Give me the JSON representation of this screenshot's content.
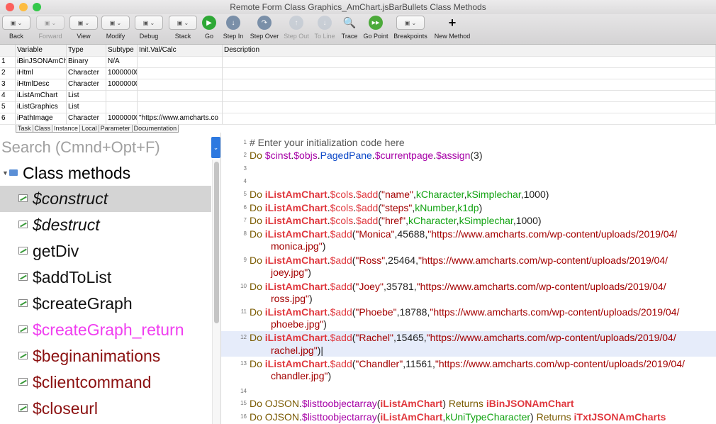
{
  "window": {
    "title": "Remote Form Class Graphics_AmChart.jsBarBullets Class Methods",
    "lights": [
      "#fc605c",
      "#fdbc40",
      "#34c84a"
    ]
  },
  "toolbar": [
    {
      "label": "Back",
      "icon": "back-arrow-icon",
      "disabled": false
    },
    {
      "label": "Forward",
      "icon": "forward-arrow-icon",
      "disabled": true
    },
    {
      "label": "View",
      "icon": "view-icon",
      "disabled": false
    },
    {
      "label": "Modify",
      "icon": "modify-icon",
      "disabled": false
    },
    {
      "label": "Debug",
      "icon": "debug-icon",
      "disabled": false
    },
    {
      "label": "Stack",
      "icon": "stack-icon",
      "disabled": false
    },
    {
      "label": "Go",
      "icon": "go-play-icon",
      "disabled": false
    },
    {
      "label": "Step In",
      "icon": "step-in-icon",
      "disabled": false
    },
    {
      "label": "Step Over",
      "icon": "step-over-icon",
      "disabled": false
    },
    {
      "label": "Step Out",
      "icon": "step-out-icon",
      "disabled": true
    },
    {
      "label": "To Line",
      "icon": "to-line-icon",
      "disabled": true
    },
    {
      "label": "Trace",
      "icon": "trace-icon",
      "disabled": false
    },
    {
      "label": "Go Point",
      "icon": "go-point-icon",
      "disabled": false
    },
    {
      "label": "Breakpoints",
      "icon": "breakpoints-icon",
      "disabled": false
    },
    {
      "label": "New Method",
      "icon": "plus-icon",
      "disabled": false
    }
  ],
  "variables": {
    "headers": [
      "",
      "Variable",
      "Type",
      "Subtype",
      "Init.Val/Calc",
      "Description"
    ],
    "rows": [
      [
        "1",
        "iBinJSONAmCh",
        "Binary",
        "N/A",
        "",
        ""
      ],
      [
        "2",
        "iHtml",
        "Character",
        "10000000",
        "",
        ""
      ],
      [
        "3",
        "iHtmlDesc",
        "Character",
        "10000000",
        "",
        ""
      ],
      [
        "4",
        "iListAmChart",
        "List",
        "",
        "",
        ""
      ],
      [
        "5",
        "iListGraphics",
        "List",
        "",
        "",
        ""
      ],
      [
        "6",
        "iPathImage",
        "Character",
        "10000000",
        "\"https://www.amcharts.co",
        ""
      ]
    ]
  },
  "var_tabs": [
    "Task",
    "Class",
    "Instance",
    "Local",
    "Parameter",
    "Documentation"
  ],
  "search": {
    "placeholder": "Search (Cmnd+Opt+F)"
  },
  "tree": {
    "root": "Class methods",
    "methods": [
      {
        "name": "$construct",
        "style": "italic",
        "color": "#111111",
        "selected": true
      },
      {
        "name": "$destruct",
        "style": "italic",
        "color": "#111111",
        "selected": false
      },
      {
        "name": "getDiv",
        "style": "normal",
        "color": "#111111",
        "selected": false
      },
      {
        "name": "$addToList",
        "style": "normal",
        "color": "#111111",
        "selected": false
      },
      {
        "name": "$createGraph",
        "style": "normal",
        "color": "#111111",
        "selected": false
      },
      {
        "name": "$createGraph_return",
        "style": "normal",
        "color": "#f03ef0",
        "selected": false
      },
      {
        "name": "$beginanimations",
        "style": "normal",
        "color": "#8b1010",
        "selected": false
      },
      {
        "name": "$clientcommand",
        "style": "normal",
        "color": "#8b1010",
        "selected": false
      },
      {
        "name": "$closeurl",
        "style": "normal",
        "color": "#8b1010",
        "selected": false
      }
    ]
  },
  "code": [
    {
      "n": "1",
      "parts": [
        [
          "cm",
          "# Enter your initialization code here"
        ]
      ]
    },
    {
      "n": "2",
      "parts": [
        [
          "kw",
          "Do "
        ],
        [
          "fn",
          "$cinst"
        ],
        [
          "plain",
          "."
        ],
        [
          "fn",
          "$objs"
        ],
        [
          "plain",
          "."
        ],
        [
          "prop",
          "PagedPane"
        ],
        [
          "plain",
          "."
        ],
        [
          "fn",
          "$currentpage"
        ],
        [
          "plain",
          "."
        ],
        [
          "fn",
          "$assign"
        ],
        [
          "plain",
          "(3)"
        ]
      ]
    },
    {
      "n": "3",
      "parts": []
    },
    {
      "n": "4",
      "parts": []
    },
    {
      "n": "5",
      "parts": [
        [
          "kw",
          "Do "
        ],
        [
          "var",
          "iListAmChart"
        ],
        [
          "plain",
          "."
        ],
        [
          "pv",
          "$cols"
        ],
        [
          "plain",
          "."
        ],
        [
          "pv",
          "$add"
        ],
        [
          "plain",
          "("
        ],
        [
          "str",
          "\"name\""
        ],
        [
          "plain",
          ","
        ],
        [
          "kc",
          "kCharacter"
        ],
        [
          "plain",
          ","
        ],
        [
          "kc",
          "kSimplechar"
        ],
        [
          "plain",
          ",1000)"
        ]
      ]
    },
    {
      "n": "6",
      "parts": [
        [
          "kw",
          "Do "
        ],
        [
          "var",
          "iListAmChart"
        ],
        [
          "plain",
          "."
        ],
        [
          "pv",
          "$cols"
        ],
        [
          "plain",
          "."
        ],
        [
          "pv",
          "$add"
        ],
        [
          "plain",
          "("
        ],
        [
          "str",
          "\"steps\""
        ],
        [
          "plain",
          ","
        ],
        [
          "kc",
          "kNumber"
        ],
        [
          "plain",
          ","
        ],
        [
          "kc",
          "k1dp"
        ],
        [
          "plain",
          ")"
        ]
      ]
    },
    {
      "n": "7",
      "parts": [
        [
          "kw",
          "Do "
        ],
        [
          "var",
          "iListAmChart"
        ],
        [
          "plain",
          "."
        ],
        [
          "pv",
          "$cols"
        ],
        [
          "plain",
          "."
        ],
        [
          "pv",
          "$add"
        ],
        [
          "plain",
          "("
        ],
        [
          "str",
          "\"href\""
        ],
        [
          "plain",
          ","
        ],
        [
          "kc",
          "kCharacter"
        ],
        [
          "plain",
          ","
        ],
        [
          "kc",
          "kSimplechar"
        ],
        [
          "plain",
          ",1000)"
        ]
      ]
    },
    {
      "n": "8",
      "parts": [
        [
          "kw",
          "Do "
        ],
        [
          "var",
          "iListAmChart"
        ],
        [
          "plain",
          "."
        ],
        [
          "pv",
          "$add"
        ],
        [
          "plain",
          "("
        ],
        [
          "str",
          "\"Monica\""
        ],
        [
          "plain",
          ",45688,"
        ],
        [
          "str",
          "\"https://www.amcharts.com/wp-content/uploads/2019/04/"
        ]
      ]
    },
    {
      "n": "",
      "cont": true,
      "parts": [
        [
          "str",
          "monica.jpg\""
        ],
        [
          "plain",
          ")"
        ]
      ]
    },
    {
      "n": "9",
      "parts": [
        [
          "kw",
          "Do "
        ],
        [
          "var",
          "iListAmChart"
        ],
        [
          "plain",
          "."
        ],
        [
          "pv",
          "$add"
        ],
        [
          "plain",
          "("
        ],
        [
          "str",
          "\"Ross\""
        ],
        [
          "plain",
          ",25464,"
        ],
        [
          "str",
          "\"https://www.amcharts.com/wp-content/uploads/2019/04/"
        ]
      ]
    },
    {
      "n": "",
      "cont": true,
      "parts": [
        [
          "str",
          "joey.jpg\""
        ],
        [
          "plain",
          ")"
        ]
      ]
    },
    {
      "n": "10",
      "parts": [
        [
          "kw",
          "Do "
        ],
        [
          "var",
          "iListAmChart"
        ],
        [
          "plain",
          "."
        ],
        [
          "pv",
          "$add"
        ],
        [
          "plain",
          "("
        ],
        [
          "str",
          "\"Joey\""
        ],
        [
          "plain",
          ",35781,"
        ],
        [
          "str",
          "\"https://www.amcharts.com/wp-content/uploads/2019/04/"
        ]
      ]
    },
    {
      "n": "",
      "cont": true,
      "parts": [
        [
          "str",
          "ross.jpg\""
        ],
        [
          "plain",
          ")"
        ]
      ]
    },
    {
      "n": "11",
      "parts": [
        [
          "kw",
          "Do "
        ],
        [
          "var",
          "iListAmChart"
        ],
        [
          "plain",
          "."
        ],
        [
          "pv",
          "$add"
        ],
        [
          "plain",
          "("
        ],
        [
          "str",
          "\"Phoebe\""
        ],
        [
          "plain",
          ",18788,"
        ],
        [
          "str",
          "\"https://www.amcharts.com/wp-content/uploads/2019/04/"
        ]
      ]
    },
    {
      "n": "",
      "cont": true,
      "parts": [
        [
          "str",
          "phoebe.jpg\""
        ],
        [
          "plain",
          ")"
        ]
      ]
    },
    {
      "n": "12",
      "hl": true,
      "parts": [
        [
          "kw",
          "Do "
        ],
        [
          "var",
          "iListAmChart"
        ],
        [
          "plain",
          "."
        ],
        [
          "pv",
          "$add"
        ],
        [
          "plain",
          "("
        ],
        [
          "str",
          "\"Rachel\""
        ],
        [
          "plain",
          ",15465,"
        ],
        [
          "str",
          "\"https://www.amcharts.com/wp-content/uploads/2019/04/"
        ]
      ]
    },
    {
      "n": "",
      "cont": true,
      "hl": true,
      "parts": [
        [
          "str",
          "rachel.jpg\""
        ],
        [
          "plain",
          ")|"
        ]
      ]
    },
    {
      "n": "13",
      "parts": [
        [
          "kw",
          "Do "
        ],
        [
          "var",
          "iListAmChart"
        ],
        [
          "plain",
          "."
        ],
        [
          "pv",
          "$add"
        ],
        [
          "plain",
          "("
        ],
        [
          "str",
          "\"Chandler\""
        ],
        [
          "plain",
          ",11561,"
        ],
        [
          "str",
          "\"https://www.amcharts.com/wp-content/uploads/2019/04/"
        ]
      ]
    },
    {
      "n": "",
      "cont": true,
      "parts": [
        [
          "str",
          "chandler.jpg\""
        ],
        [
          "plain",
          ")"
        ]
      ]
    },
    {
      "n": "14",
      "parts": []
    },
    {
      "n": "15",
      "parts": [
        [
          "kw",
          "Do "
        ],
        [
          "ojson",
          "OJSON"
        ],
        [
          "plain",
          "."
        ],
        [
          "fn",
          "$listtoobjectarray"
        ],
        [
          "plain",
          "("
        ],
        [
          "var",
          "iListAmChart"
        ],
        [
          "plain",
          ") "
        ],
        [
          "ret",
          "Returns "
        ],
        [
          "var",
          "iBinJSONAmChart"
        ]
      ]
    },
    {
      "n": "16",
      "parts": [
        [
          "kw",
          "Do "
        ],
        [
          "ojson",
          "OJSON"
        ],
        [
          "plain",
          "."
        ],
        [
          "fn",
          "$listtoobjectarray"
        ],
        [
          "plain",
          "("
        ],
        [
          "var",
          "iListAmChart"
        ],
        [
          "plain",
          ","
        ],
        [
          "kc",
          "kUniTypeCharacter"
        ],
        [
          "plain",
          ") "
        ],
        [
          "ret",
          "Returns "
        ],
        [
          "var",
          "iTxtJSONAmCharts"
        ]
      ]
    }
  ]
}
